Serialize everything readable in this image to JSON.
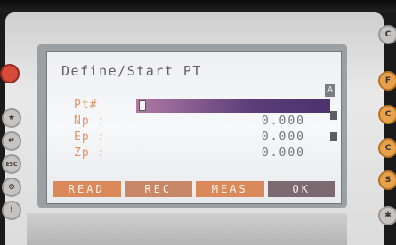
{
  "screen": {
    "title": "Define/Start PT",
    "mode_flag": "A",
    "fields": [
      {
        "label": "Pt#",
        "value": ""
      },
      {
        "label": "Np  :",
        "value": "0.000"
      },
      {
        "label": "Ep  :",
        "value": "0.000"
      },
      {
        "label": "Zp  :",
        "value": "0.000"
      }
    ],
    "softkeys": [
      "READ",
      "REC",
      "MEAS",
      "OK"
    ]
  },
  "side_buttons_left": [
    "★",
    "↵",
    "ESC",
    "⊙",
    "!"
  ],
  "side_buttons_right": [
    "C",
    "F",
    "C",
    "C",
    "S",
    "✱"
  ],
  "colors": {
    "screen_bg": "#f3f4f6",
    "label_orange": "#e39467",
    "softkey_orange": "#d9895a",
    "input_purple": "#5a3d78"
  }
}
